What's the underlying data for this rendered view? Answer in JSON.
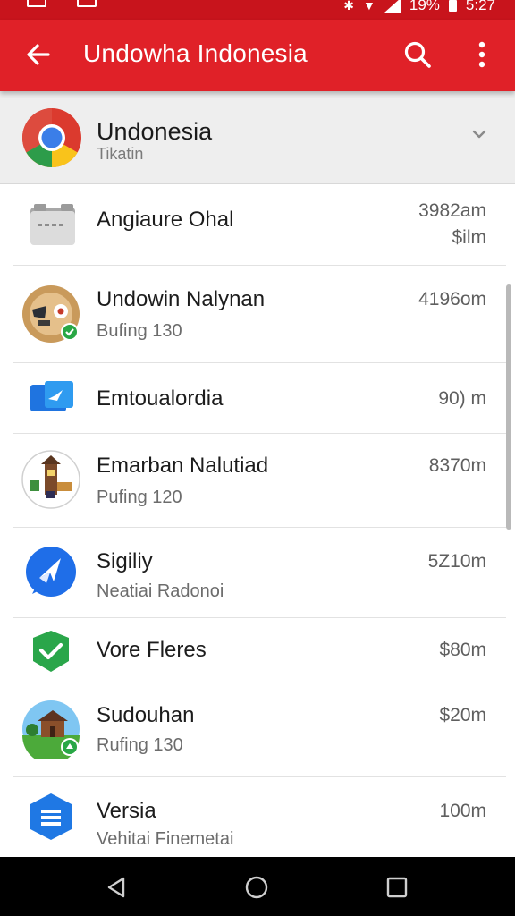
{
  "status_bar": {
    "battery_text": "19%",
    "time": "5:27",
    "icons": [
      "notification-icon",
      "image-icon",
      "bluetooth-icon",
      "wifi-icon",
      "signal-icon",
      "battery-icon"
    ]
  },
  "app_bar": {
    "title": "Undowha Indonesia",
    "back_icon": "arrow-left-icon",
    "search_icon": "search-icon",
    "more_icon": "more-vert-icon",
    "color": "#e02128"
  },
  "header": {
    "title": "Undonesia",
    "subtitle": "Tikatin",
    "icon": "chrome-icon",
    "chevron_icon": "chevron-down-icon"
  },
  "apps": [
    {
      "name": "Angiaure Ohal",
      "subtitle": "",
      "size": "3982am",
      "size2": "$ilm",
      "icon": "folder-icon"
    },
    {
      "name": "Undowin Nalynan",
      "subtitle": "Bufing 130",
      "size": "4196om",
      "size2": "",
      "icon": "coffee-app-icon"
    },
    {
      "name": "Emtoualordia",
      "subtitle": "",
      "size": "90) m",
      "size2": "",
      "icon": "mail-app-icon"
    },
    {
      "name": "Emarban Nalutiad",
      "subtitle": "Pufing 120",
      "size": "8370m",
      "size2": "",
      "icon": "tower-game-icon"
    },
    {
      "name": "Sigiliy",
      "subtitle": "Neatiai Radonoi",
      "size": "5Z10m",
      "size2": "",
      "icon": "messenger-icon"
    },
    {
      "name": "Vore Fleres",
      "subtitle": "",
      "size": "$80m",
      "size2": "",
      "icon": "check-app-icon"
    },
    {
      "name": "Sudouhan",
      "subtitle": "Rufing 130",
      "size": "$20m",
      "size2": "",
      "icon": "farm-game-icon"
    },
    {
      "name": "Versia",
      "subtitle": "Vehitai Finemetai",
      "size": "100m",
      "size2": "",
      "icon": "document-app-icon"
    }
  ],
  "nav_bar": {
    "back_icon": "nav-back-icon",
    "home_icon": "nav-home-icon",
    "recent_icon": "nav-recent-icon"
  }
}
